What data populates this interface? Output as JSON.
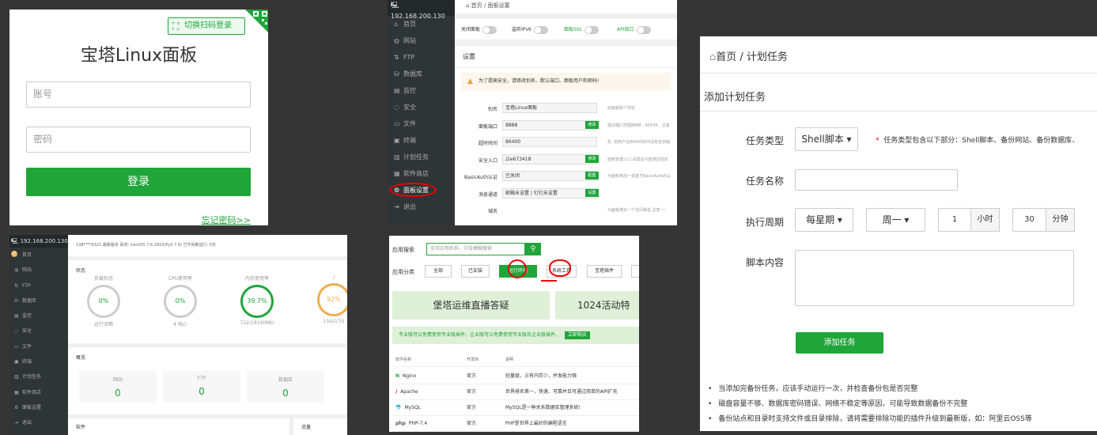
{
  "login": {
    "qr_switch": "切换扫码登录",
    "title": "宝塔Linux面板",
    "username_placeholder": "账号",
    "password_placeholder": "密码",
    "login_button": "登录",
    "forgot": "忘记密码>>"
  },
  "settings": {
    "ip": "192.168.200.130",
    "sidebar": [
      "首页",
      "网站",
      "FTP",
      "数据库",
      "监控",
      "安全",
      "文件",
      "终端",
      "计划任务",
      "软件商店",
      "面板设置",
      "退出"
    ],
    "sidebar_icons": [
      "home-icon",
      "globe-icon",
      "ftp-icon",
      "database-icon",
      "monitor-icon",
      "shield-icon",
      "folder-icon",
      "terminal-icon",
      "calendar-icon",
      "store-icon",
      "gear-icon",
      "logout-icon"
    ],
    "breadcrumb": "首页 / 面板设置",
    "toggles": [
      "关闭面板",
      "监听IPv6",
      "面板SSL",
      "API接口"
    ],
    "section_title": "设置",
    "warning": "为了提高安全，请修改别名、默认端口、面板用户和密码!",
    "rows": [
      {
        "label": "别名",
        "value": "宝塔Linux面板",
        "button": "",
        "desc": "给面板取个别名"
      },
      {
        "label": "面板端口",
        "value": "8888",
        "button": "修改",
        "desc": "建议端口范围8888 - 65535，注意"
      },
      {
        "label": "超时时间",
        "value": "86400",
        "button": "",
        "desc": "秒, 如用户在86400秒内没有任何操"
      },
      {
        "label": "安全入口",
        "value": "/2e673418",
        "button": "修改",
        "desc": "面板管理入口,设置后只能通过指定"
      },
      {
        "label": "BasicAuth认证",
        "value": "已关闭",
        "button": "配置",
        "desc": "为面板增加一道基于BasicAuth的认"
      },
      {
        "label": "消息通道",
        "value": "邮箱未设置 | 钉钉未设置",
        "button": "设置",
        "desc": ""
      },
      {
        "label": "域名",
        "value": "",
        "button": "",
        "desc": "为面板绑定一个访问域名;注意:一"
      }
    ]
  },
  "cron": {
    "breadcrumb": "首页 / 计划任务",
    "title": "添加计划任务",
    "task_type_label": "任务类型",
    "task_type_value": "Shell脚本",
    "note_star": "*",
    "note": "任务类型包含以下部分：Shell脚本、备份网站、备份数据库、",
    "task_name_label": "任务名称",
    "period_label": "执行周期",
    "period_value": "每星期",
    "weekday_value": "周一",
    "hour_value": "1",
    "hour_unit": "小时",
    "minute_value": "30",
    "minute_unit": "分钟",
    "script_label": "脚本内容",
    "add_button": "添加任务",
    "tips": [
      "当添加完备份任务，应该手动运行一次，并检查备份包是否完整",
      "磁盘容量不够、数据库密码错误、网络不稳定等原因，可能导致数据备份不完整",
      "备份站点和目录时支持文件或目录排除，请将需要排除功能的插件升级到最新版，如：阿里云OSS等"
    ]
  },
  "home": {
    "ip": "192.168.200.130",
    "badge": "0",
    "sidebar": [
      "首页",
      "网站",
      "FTP",
      "数据库",
      "监控",
      "安全",
      "文件",
      "终端",
      "计划任务",
      "软件商店",
      "面板设置",
      "退出"
    ],
    "topbar": "138****9321   最新版本   系统: CentOS 7.6.1810(Py3.7.8)   已不间断运行: 0天",
    "status_title": "状态",
    "gauges": [
      {
        "name": "负载状态",
        "value": "0%",
        "label": "运行流畅"
      },
      {
        "name": "CPU使用率",
        "value": "0%",
        "label": "4 核心"
      },
      {
        "name": "内存使用率",
        "value": "39.7%",
        "label": "722/1819(MB)"
      },
      {
        "name": "/",
        "value": "92%",
        "label": "15G/17G"
      }
    ],
    "overview_title": "概览",
    "stats": [
      {
        "name": "网站",
        "value": "0"
      },
      {
        "name": "FTP",
        "value": "0"
      },
      {
        "name": "数据库",
        "value": "0"
      }
    ],
    "software_title": "软件",
    "traffic_title": "流量"
  },
  "store": {
    "search_label": "应用搜索",
    "search_placeholder": "支持应用名称、字段模糊搜索",
    "category_label": "应用分类",
    "tabs": [
      "全部",
      "已安装",
      "运行环境",
      "系统工具",
      "宝塔插件"
    ],
    "banner1": "堡塔运维直播答疑",
    "banner2": "1024活动特",
    "promo": "专业版可以免费使用专业版插件，企业版可以免费使用专业版及企业版插件。",
    "promo_button": "立即购买",
    "headers": [
      "软件名称",
      "开发商",
      "说明"
    ],
    "rows": [
      {
        "name": "Nginx",
        "dev": "官方",
        "desc": "轻量级，占有内存少，并发能力强"
      },
      {
        "name": "Apache",
        "dev": "官方",
        "desc": "世界排名第一，快速、可靠并且可通过简单的API扩充"
      },
      {
        "name": "MySQL",
        "dev": "官方",
        "desc": "MySQL是一种关系数据库管理系统!"
      },
      {
        "name": "PHP-7.4",
        "dev": "官方",
        "desc": "PHP是世界上最好的编程语言"
      }
    ]
  }
}
